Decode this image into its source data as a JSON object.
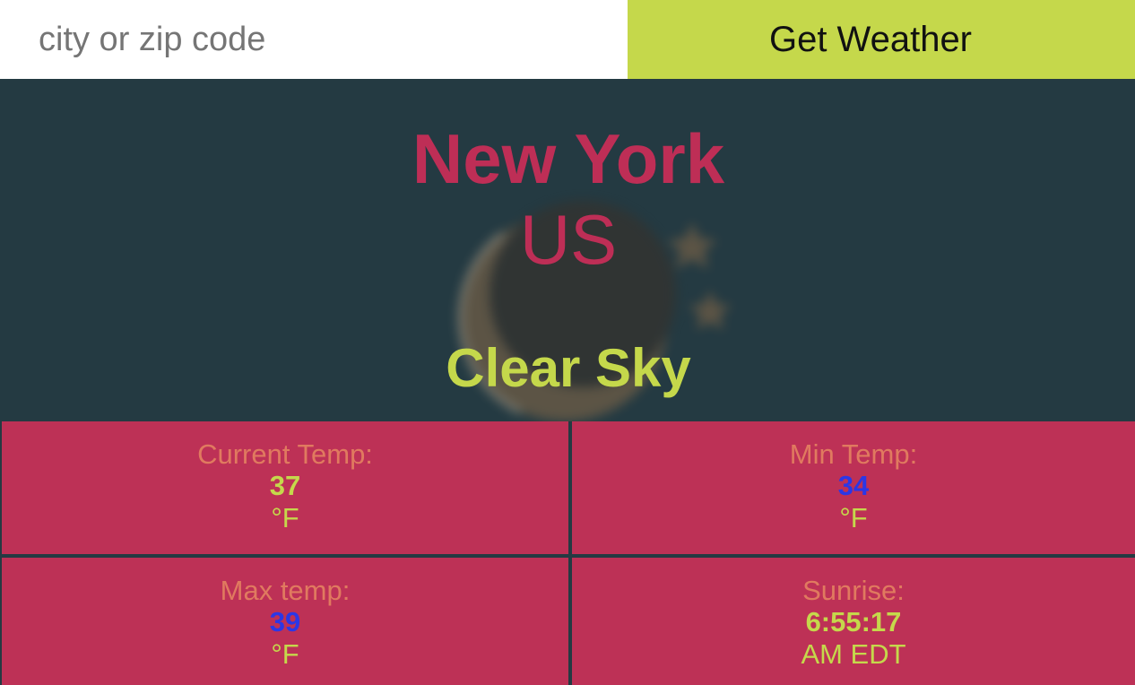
{
  "search": {
    "placeholder": "city or zip code",
    "value": ""
  },
  "button": {
    "label": "Get Weather"
  },
  "location": {
    "city": "New York",
    "country": "US"
  },
  "weather": {
    "condition": "Clear Sky",
    "icon": "moon-and-stars-icon"
  },
  "stats": [
    {
      "label": "Current Temp:",
      "value": "37",
      "unit": "°F",
      "value_color": "#c5d84b"
    },
    {
      "label": "Min Temp:",
      "value": "34",
      "unit": "°F",
      "value_color": "#2b37e6"
    },
    {
      "label": "Max temp:",
      "value": "39",
      "unit": "°F",
      "value_color": "#2b37e6"
    },
    {
      "label": "Sunrise:",
      "value": "6:55:17",
      "unit": "AM EDT",
      "value_color": "#c5d84b"
    }
  ],
  "colors": {
    "accent": "#c5d84b",
    "panel": "#bd3156",
    "background": "#243a42",
    "city_text": "#be2e56",
    "label_text": "#e07a5f",
    "blue_value": "#2b37e6"
  }
}
